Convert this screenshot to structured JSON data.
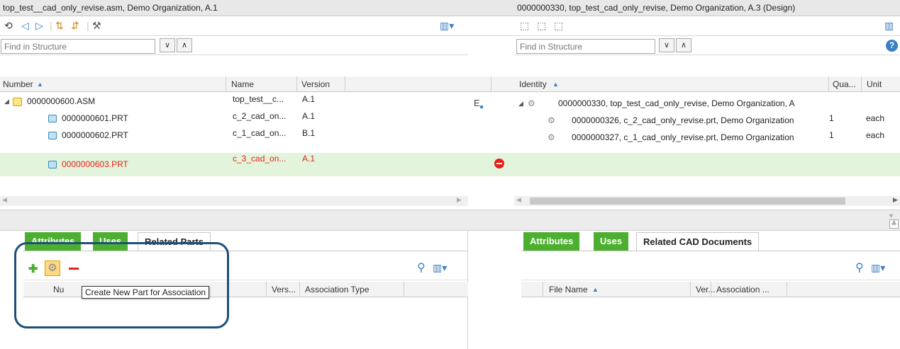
{
  "left_panel": {
    "title": "top_test__cad_only_revise.asm, Demo Organization, A.1",
    "find_placeholder": "Find in Structure",
    "columns": [
      "Number",
      "Name",
      "Version"
    ],
    "rows": [
      {
        "number": "0000000600.ASM",
        "name": "top_test__c...",
        "version": "A.1"
      },
      {
        "number": "0000000601.PRT",
        "name": "c_2_cad_on...",
        "version": "A.1"
      },
      {
        "number": "0000000602.PRT",
        "name": "c_1_cad_on...",
        "version": "B.1"
      },
      {
        "number": "0000000603.PRT",
        "name": "c_3_cad_on...",
        "version": "A.1"
      }
    ]
  },
  "right_panel": {
    "title": "0000000330, top_test_cad_only_revise, Demo Organization, A.3 (Design)",
    "find_placeholder": "Find in Structure",
    "columns": [
      "Identity",
      "Qua...",
      "Unit"
    ],
    "rows": [
      {
        "identity": "0000000330, top_test_cad_only_revise, Demo Organization, A",
        "qty": "",
        "unit": ""
      },
      {
        "identity": "0000000326, c_2_cad_only_revise.prt, Demo Organization",
        "qty": "1",
        "unit": "each"
      },
      {
        "identity": "0000000327, c_1_cad_only_revise.prt, Demo Organization",
        "qty": "1",
        "unit": "each"
      }
    ]
  },
  "left_bottom": {
    "tabs": [
      "Attributes",
      "Uses",
      "Related Parts"
    ],
    "columns": [
      "Nu",
      "Vers...",
      "Association Type"
    ],
    "tooltip": "Create New Part for Association"
  },
  "right_bottom": {
    "tabs": [
      "Attributes",
      "Uses",
      "Related CAD Documents"
    ],
    "columns": [
      "File Name",
      "Ver...",
      "Association ..."
    ]
  },
  "colors": {
    "green_tab": "#4caf2f",
    "highlight_row": "#e2f5dc",
    "red_text": "#e8201a",
    "callout": "#1f4e79"
  }
}
